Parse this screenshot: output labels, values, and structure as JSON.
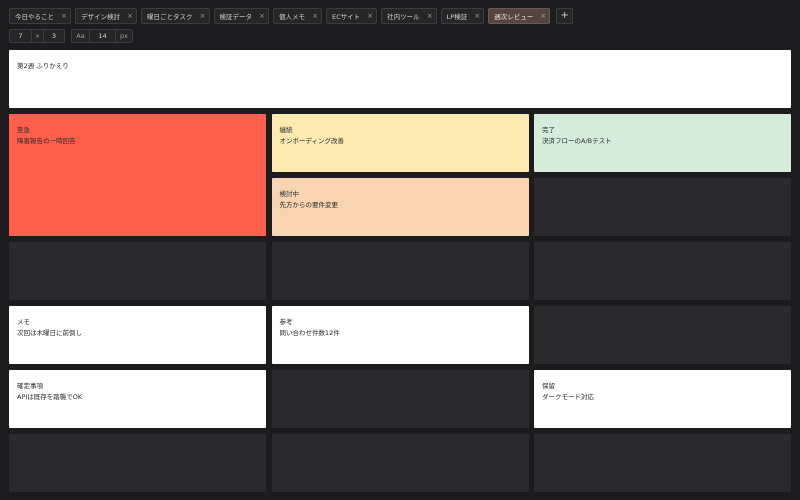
{
  "tabs": [
    {
      "label": "今日やること",
      "active": false
    },
    {
      "label": "デザイン検討",
      "active": false
    },
    {
      "label": "曜日ごとタスク",
      "active": false
    },
    {
      "label": "検証データ",
      "active": false
    },
    {
      "label": "個人メモ",
      "active": false
    },
    {
      "label": "ECサイト",
      "active": false
    },
    {
      "label": "社内ツール",
      "active": false
    },
    {
      "label": "LP検証",
      "active": false
    },
    {
      "label": "週次レビュー",
      "active": true
    }
  ],
  "tab_close_glyph": "×",
  "add_tab_glyph": "+",
  "toolbar": {
    "columns": "7",
    "times_glyph": "×",
    "rows": "3",
    "font_glyph": "Aa",
    "font_size": "14",
    "unit": "px"
  },
  "title_card": {
    "text": "第2週 ふりかえり"
  },
  "notes": [
    {
      "id": "urgent",
      "title": "至急",
      "body": "障害報告の一時回答",
      "color": "#ff5f4d"
    },
    {
      "id": "continue",
      "title": "継続",
      "body": "オンボーディング改善",
      "color": "#fdeab0"
    },
    {
      "id": "done",
      "title": "完了",
      "body": "決済フローのA/Bテスト",
      "color": "#d6ecda"
    },
    {
      "id": "reviewing",
      "title": "検討中",
      "body": "先方からの要件変更",
      "color": "#f8d4b2"
    },
    {
      "id": "memo",
      "title": "メモ",
      "body": "次回は木曜日に前倒し",
      "color": "#ffffff"
    },
    {
      "id": "reference",
      "title": "参考",
      "body": "問い合わせ件数12件",
      "color": "#ffffff"
    },
    {
      "id": "decided",
      "title": "確定事項",
      "body": "APIは既存を踏襲でOK",
      "color": "#ffffff"
    },
    {
      "id": "hold",
      "title": "保留",
      "body": "ダークモード対応",
      "color": "#ffffff"
    }
  ],
  "colors": {
    "background": "#1c1c1e",
    "empty_cell": "#2a2a2c",
    "active_tab": "#54463f"
  }
}
